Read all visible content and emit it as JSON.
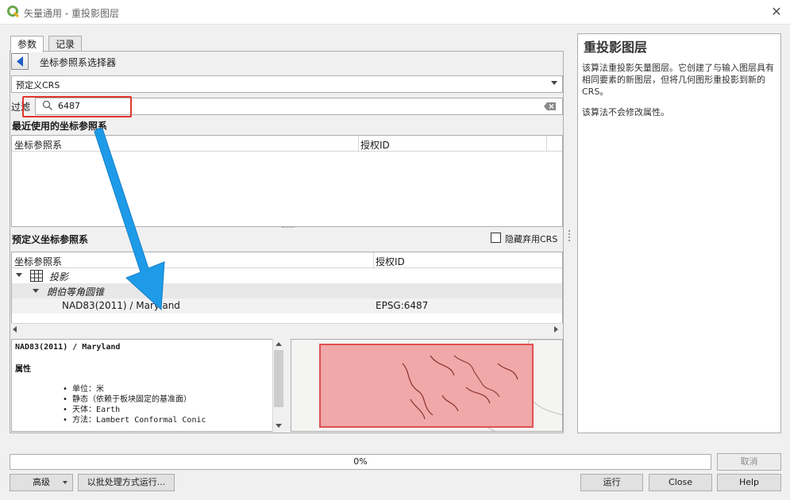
{
  "window": {
    "title": "矢量通用 - 重投影图层",
    "close_glyph": "✕"
  },
  "tabs": [
    {
      "label": "参数"
    },
    {
      "label": "记录"
    }
  ],
  "selector": {
    "title": "坐标参照系选择器"
  },
  "crs_combo": {
    "value": "预定义CRS"
  },
  "filter": {
    "label": "过滤",
    "value": "6487"
  },
  "recent": {
    "title": "最近使用的坐标参照系",
    "columns": [
      "坐标参照系",
      "授权ID"
    ]
  },
  "predefined": {
    "title": "预定义坐标参照系",
    "hide_deprecated_label": "隐藏弃用CRS",
    "hide_deprecated_checked": false,
    "columns": [
      "坐标参照系",
      "授权ID"
    ],
    "rows": [
      {
        "label": "投影",
        "level": 0
      },
      {
        "label": "朗伯等角圆锥",
        "level": 1
      },
      {
        "label": "NAD83(2011) / Maryland",
        "auth_id": "EPSG:6487",
        "level": 2
      }
    ]
  },
  "details": {
    "name": "NAD83(2011) / Maryland",
    "section": "属性",
    "items": [
      "单位：米",
      "静态（依赖于板块固定的基准面）",
      "天体：Earth",
      "方法：Lambert Conformal Conic"
    ]
  },
  "help": {
    "title": "重投影图层",
    "paragraph1": "该算法重投影矢量图层。它创建了与输入图层具有相同要素的新图层，但将几何图形重投影到新的CRS。",
    "paragraph2": "该算法不会修改属性。"
  },
  "progress": {
    "value": 0,
    "text": "0%"
  },
  "buttons": {
    "cancel": "取消",
    "advanced": "高级",
    "batch": "以批处理方式运行...",
    "run": "运行",
    "close": "Close",
    "help": "Help"
  },
  "colors": {
    "highlight": "#e0362c",
    "arrow": "#1e9be8",
    "extent_fill": "#f0a8a8",
    "extent_stroke": "#e05050"
  },
  "icons": [
    "qgis-logo-icon",
    "back-arrow-icon",
    "search-icon",
    "clear-icon",
    "chevron-down-icon",
    "grid-icon",
    "expand-icon"
  ]
}
